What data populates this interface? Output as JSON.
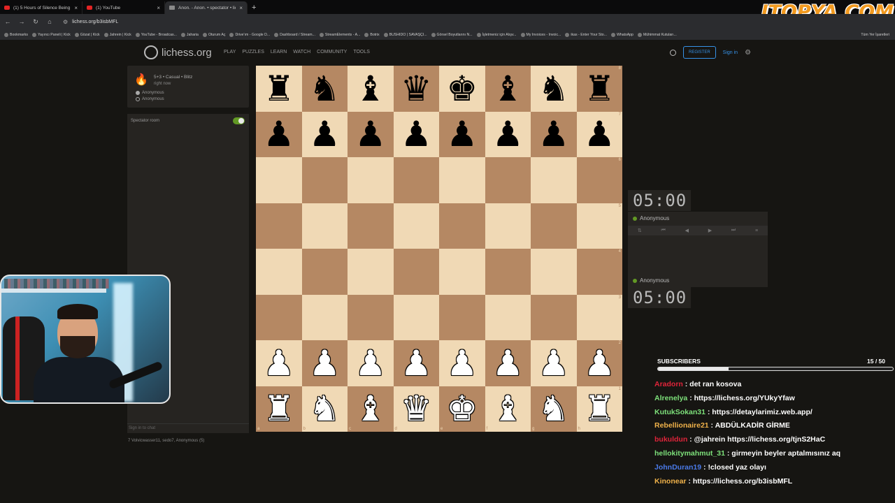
{
  "browser": {
    "tabs": [
      {
        "label": "(1) 5 Hours of Silence Being Ra",
        "icon": "youtube-icon"
      },
      {
        "label": "(1) YouTube",
        "icon": "youtube-icon"
      },
      {
        "label": "Anon. - Anon. • spectator • lich",
        "icon": "lichess-icon"
      }
    ],
    "url": "lichess.org/b3isbMFL",
    "bookmarks": [
      "Bookmarks",
      "Yayıncı Paneli | Kick",
      "Gözat | Kick",
      "Jahrein | Kick",
      "YouTube - Broadcas...",
      "Jaharia",
      "Oturum Aç",
      "Drive'ım - Google D...",
      "Dashboard / Stream...",
      "StreamElements - A...",
      "Botrix",
      "BUSHIDO | SAVAŞÇI...",
      "Görsel Boyutlarını N...",
      "İşletmeniz için Alışv...",
      "My Invoices - Invoic...",
      "ikas - Enter Your Sto...",
      "WhatsApp",
      "Mühimmat Kutuları..."
    ],
    "bookmarks_right": "Tüm Yer İşaretleri",
    "overlay_logo": "ITOPYA.COM"
  },
  "lichess": {
    "brand": "lichess.org",
    "nav": [
      "PLAY",
      "PUZZLES",
      "LEARN",
      "WATCH",
      "COMMUNITY",
      "TOOLS"
    ],
    "register": "REGISTER",
    "signin": "Sign in",
    "game": {
      "title": "5+3 • Casual • Blitz",
      "time": "right now",
      "white": "Anonymous",
      "black": "Anonymous"
    },
    "spectator_room": "Spectator room",
    "chat_placeholder": "Sign in to chat",
    "watchers": "7  Volvicwasser11, sedo7, Anonymous (5)",
    "clock_top": "05:00",
    "clock_bottom": "05:00",
    "player_top": "Anonymous",
    "player_bottom": "Anonymous",
    "board": [
      [
        "♜",
        "♞",
        "♝",
        "♛",
        "♚",
        "♝",
        "♞",
        "♜"
      ],
      [
        "♟",
        "♟",
        "♟",
        "♟",
        "♟",
        "♟",
        "♟",
        "♟"
      ],
      [
        "",
        "",
        "",
        "",
        "",
        "",
        "",
        ""
      ],
      [
        "",
        "",
        "",
        "",
        "",
        "",
        "",
        ""
      ],
      [
        "",
        "",
        "",
        "",
        "",
        "",
        "",
        ""
      ],
      [
        "",
        "",
        "",
        "",
        "",
        "",
        "",
        ""
      ],
      [
        "♟",
        "♟",
        "♟",
        "♟",
        "♟",
        "♟",
        "♟",
        "♟"
      ],
      [
        "♜",
        "♞",
        "♝",
        "♛",
        "♚",
        "♝",
        "♞",
        "♜"
      ]
    ],
    "ranks": [
      "8",
      "7",
      "6",
      "5",
      "4",
      "3",
      "2",
      "1"
    ],
    "files": [
      "a",
      "b",
      "c",
      "d",
      "e",
      "f",
      "g",
      "h"
    ]
  },
  "stream": {
    "subscribers_label": "SUBSCRIBERS",
    "subscribers_count": "15 / 50",
    "subscribers_progress": 0.3,
    "chat": [
      {
        "user": "Aradorn",
        "color": "#e0243a",
        "text": " : det ran kosova"
      },
      {
        "user": "Alrenelya",
        "color": "#7de07a",
        "text": " : https://lichess.org/YUkyYfaw"
      },
      {
        "user": "KutukSokan31",
        "color": "#7de07a",
        "text": " : https://detaylarimiz.web.app/"
      },
      {
        "user": "Rebellionaire21",
        "color": "#f0b24a",
        "text": " : ABDÜLKADİR GİRME"
      },
      {
        "user": "bukuldun",
        "color": "#e0243a",
        "text": " : @jahrein https://lichess.org/tjnS2HaC"
      },
      {
        "user": "hellokitymahmut_31",
        "color": "#7de07a",
        "text": " : girmeyin beyler aptalmısınız aq"
      },
      {
        "user": "JohnDuran19",
        "color": "#4a7ae8",
        "text": " : !closed yaz olayı"
      },
      {
        "user": "Kinonear",
        "color": "#f0b24a",
        "text": " : https://lichess.org/b3isbMFL"
      }
    ]
  }
}
